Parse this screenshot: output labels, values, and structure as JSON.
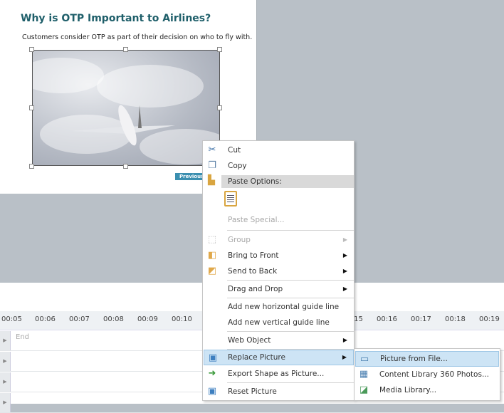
{
  "slide": {
    "title": "Why is OTP Important to Airlines?",
    "subtitle": "Customers consider OTP as part of their decision on who to fly with.",
    "previous_button": "Previous"
  },
  "timeline": {
    "ticks": [
      "00:05",
      "00:06",
      "00:07",
      "00:08",
      "00:09",
      "00:10",
      "00:15",
      "00:16",
      "00:17",
      "00:18",
      "00:19"
    ],
    "end_label": "End"
  },
  "context_menu": {
    "cut": "Cut",
    "copy": "Copy",
    "paste_options": "Paste Options:",
    "paste_special": "Paste Special...",
    "group": "Group",
    "bring_to_front": "Bring to Front",
    "send_to_back": "Send to Back",
    "drag_and_drop": "Drag and Drop",
    "add_horizontal_guide": "Add new horizontal guide line",
    "add_vertical_guide": "Add new vertical guide line",
    "web_object": "Web Object",
    "replace_picture": "Replace Picture",
    "export_shape": "Export Shape as Picture...",
    "reset_picture": "Reset Picture"
  },
  "submenu": {
    "picture_from_file": "Picture from File...",
    "content_library": "Content Library 360 Photos...",
    "media_library": "Media Library..."
  }
}
